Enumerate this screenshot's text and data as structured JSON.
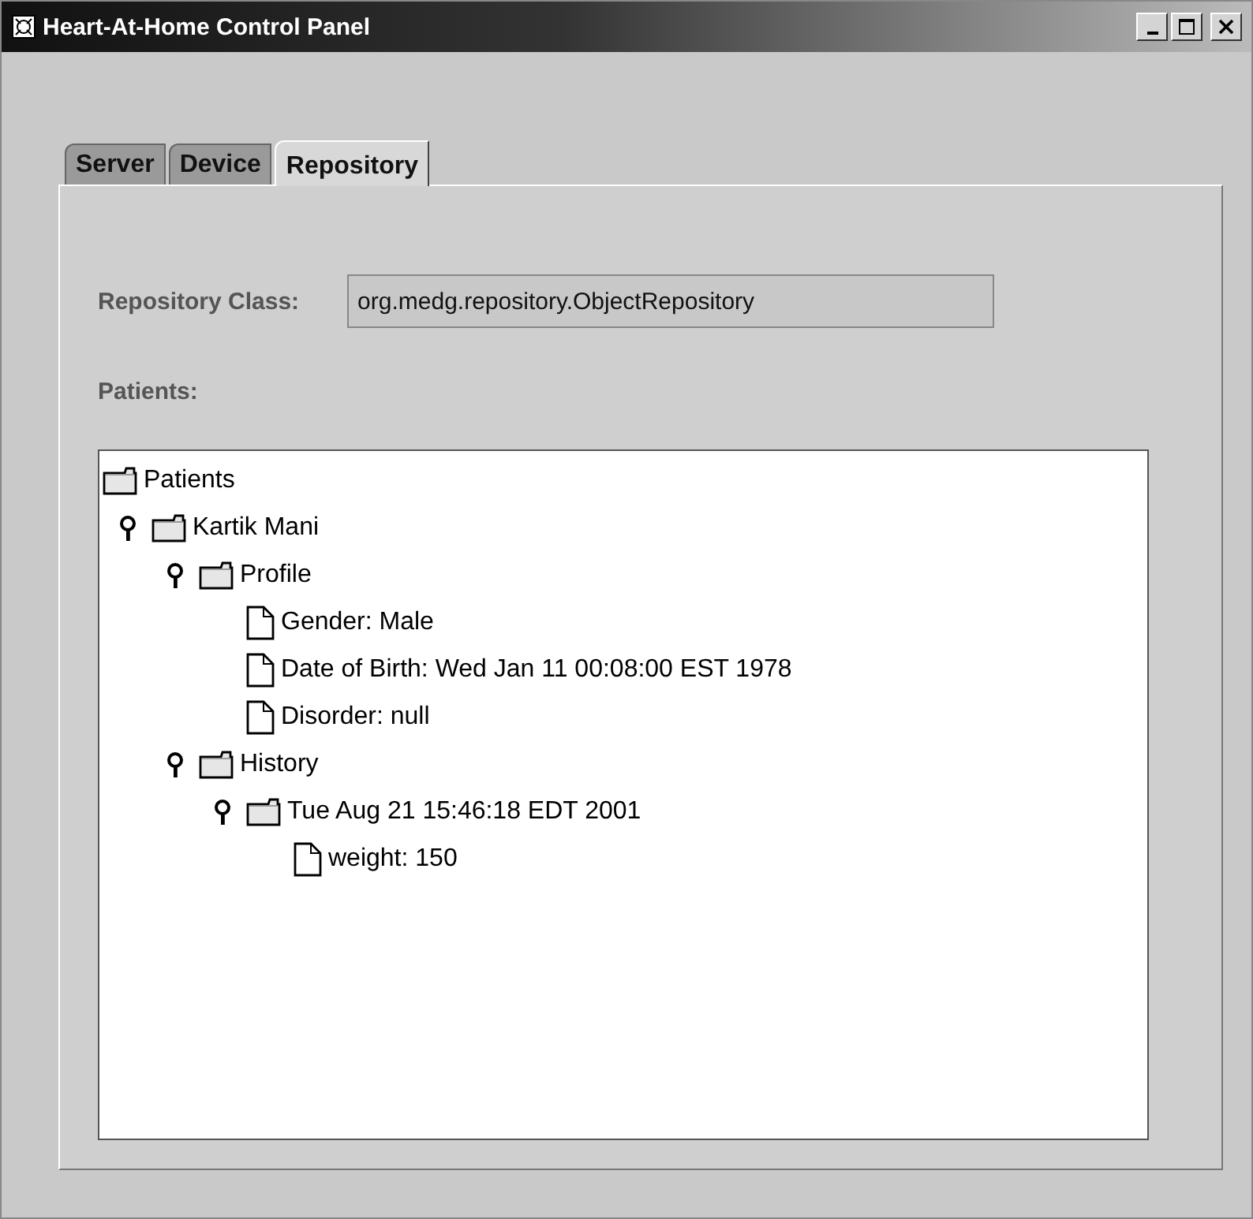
{
  "window": {
    "title": "Heart-At-Home Control Panel"
  },
  "tabs": [
    {
      "label": "Server",
      "selected": false
    },
    {
      "label": "Device",
      "selected": false
    },
    {
      "label": "Repository",
      "selected": true
    }
  ],
  "repository_class": {
    "label": "Repository Class:",
    "value": "org.medg.repository.ObjectRepository"
  },
  "patients_label": "Patients:",
  "tree": {
    "kind": "folder",
    "label": "Patients",
    "children": [
      {
        "kind": "folder",
        "label": "Kartik Mani",
        "expanded": true,
        "children": [
          {
            "kind": "folder",
            "label": "Profile",
            "expanded": true,
            "children": [
              {
                "kind": "leaf",
                "label": "Gender: Male"
              },
              {
                "kind": "leaf",
                "label": "Date of Birth: Wed Jan 11 00:08:00 EST 1978"
              },
              {
                "kind": "leaf",
                "label": "Disorder: null"
              }
            ]
          },
          {
            "kind": "folder",
            "label": "History",
            "expanded": true,
            "children": [
              {
                "kind": "folder",
                "label": "Tue Aug 21 15:46:18 EDT 2001",
                "expanded": true,
                "children": [
                  {
                    "kind": "leaf",
                    "label": "weight: 150"
                  }
                ]
              }
            ]
          }
        ]
      }
    ]
  }
}
